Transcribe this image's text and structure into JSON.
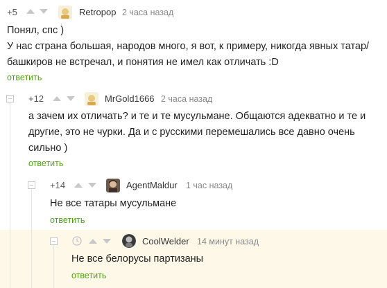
{
  "colors": {
    "reply_link": "#53a018",
    "highlight_bg": "#fdf8e8",
    "thread_line": "#e3e3e3"
  },
  "comments": [
    {
      "score": "+5",
      "username": "Retropop",
      "time": "2 часа назад",
      "lines": [
        "Понял, спс )",
        "У нас страна большая, народов много, я вот, к примеру, никогда явных татар/",
        "башкиров не встречал, и понятия не имел как отличать :D"
      ],
      "reply_label": "ответить",
      "avatar_icon": "retropop-avatar-icon"
    },
    {
      "score": "+12",
      "username": "MrGold1666",
      "time": "2 часа назад",
      "lines": [
        "а зачем их отличать? и те и те мусульмане. Общаются адекватно и те и",
        "другие, это не чурки. Да и с русскими перемешались все давно очень",
        "сильно )"
      ],
      "reply_label": "ответить",
      "avatar_icon": "mrgold-avatar-icon"
    },
    {
      "score": "+14",
      "username": "AgentMaldur",
      "time": "1 час назад",
      "lines": [
        "Не все татары мусульмане"
      ],
      "reply_label": "ответить",
      "avatar_icon": "agentmaldur-avatar-icon"
    },
    {
      "score": "",
      "username": "CoolWelder",
      "time": "14 минут назад",
      "lines": [
        "Не все белорусы партизаны"
      ],
      "reply_label": "ответить",
      "avatar_icon": "coolwelder-avatar-icon",
      "clock_icon": "clock-icon"
    }
  ]
}
